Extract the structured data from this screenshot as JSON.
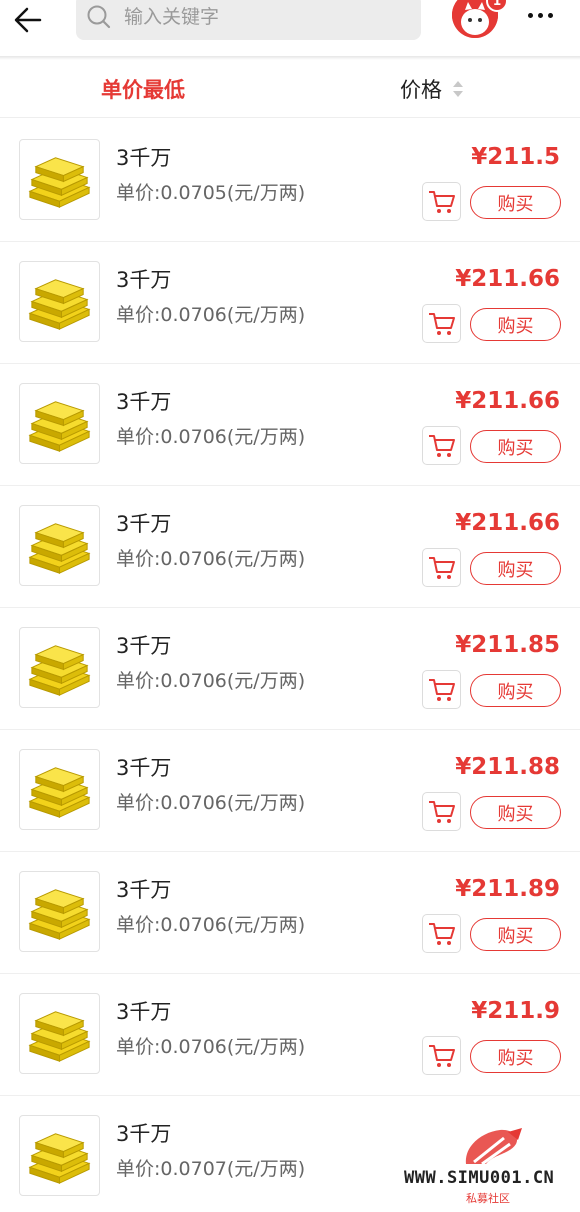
{
  "header": {
    "search_placeholder": "输入关键字",
    "badge": "1"
  },
  "sort_bar": {
    "lowest_label": "单价最低",
    "price_label": "价格"
  },
  "items": [
    {
      "title": "3千万",
      "unit_price": "单价:0.0705(元/万两)",
      "price": "¥211.5",
      "buy_label": "购买"
    },
    {
      "title": "3千万",
      "unit_price": "单价:0.0706(元/万两)",
      "price": "¥211.66",
      "buy_label": "购买"
    },
    {
      "title": "3千万",
      "unit_price": "单价:0.0706(元/万两)",
      "price": "¥211.66",
      "buy_label": "购买"
    },
    {
      "title": "3千万",
      "unit_price": "单价:0.0706(元/万两)",
      "price": "¥211.66",
      "buy_label": "购买"
    },
    {
      "title": "3千万",
      "unit_price": "单价:0.0706(元/万两)",
      "price": "¥211.85",
      "buy_label": "购买"
    },
    {
      "title": "3千万",
      "unit_price": "单价:0.0706(元/万两)",
      "price": "¥211.88",
      "buy_label": "购买"
    },
    {
      "title": "3千万",
      "unit_price": "单价:0.0706(元/万两)",
      "price": "¥211.89",
      "buy_label": "购买"
    },
    {
      "title": "3千万",
      "unit_price": "单价:0.0706(元/万两)",
      "price": "¥211.9",
      "buy_label": "购买"
    },
    {
      "title": "3千万",
      "unit_price": "单价:0.0707(元/万两)",
      "price": "",
      "buy_label": ""
    }
  ],
  "watermark": {
    "url": "WWW.SIMU001.CN",
    "sub": "私募社区"
  },
  "colors": {
    "accent": "#e53935",
    "gold": "#f2d21a"
  },
  "icons": {
    "back": "back-arrow-icon",
    "search": "search-icon",
    "more": "more-dots-icon",
    "cart": "cart-icon",
    "sort": "sort-arrows-icon",
    "product": "gold-bars-icon"
  }
}
